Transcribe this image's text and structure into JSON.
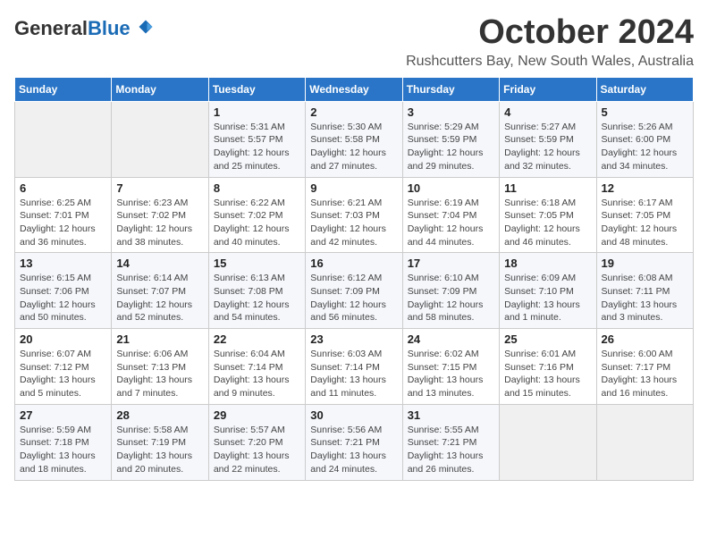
{
  "header": {
    "logo_general": "General",
    "logo_blue": "Blue",
    "month_title": "October 2024",
    "location": "Rushcutters Bay, New South Wales, Australia"
  },
  "days_of_week": [
    "Sunday",
    "Monday",
    "Tuesday",
    "Wednesday",
    "Thursday",
    "Friday",
    "Saturday"
  ],
  "weeks": [
    [
      {
        "day": "",
        "info": ""
      },
      {
        "day": "",
        "info": ""
      },
      {
        "day": "1",
        "info": "Sunrise: 5:31 AM\nSunset: 5:57 PM\nDaylight: 12 hours\nand 25 minutes."
      },
      {
        "day": "2",
        "info": "Sunrise: 5:30 AM\nSunset: 5:58 PM\nDaylight: 12 hours\nand 27 minutes."
      },
      {
        "day": "3",
        "info": "Sunrise: 5:29 AM\nSunset: 5:59 PM\nDaylight: 12 hours\nand 29 minutes."
      },
      {
        "day": "4",
        "info": "Sunrise: 5:27 AM\nSunset: 5:59 PM\nDaylight: 12 hours\nand 32 minutes."
      },
      {
        "day": "5",
        "info": "Sunrise: 5:26 AM\nSunset: 6:00 PM\nDaylight: 12 hours\nand 34 minutes."
      }
    ],
    [
      {
        "day": "6",
        "info": "Sunrise: 6:25 AM\nSunset: 7:01 PM\nDaylight: 12 hours\nand 36 minutes."
      },
      {
        "day": "7",
        "info": "Sunrise: 6:23 AM\nSunset: 7:02 PM\nDaylight: 12 hours\nand 38 minutes."
      },
      {
        "day": "8",
        "info": "Sunrise: 6:22 AM\nSunset: 7:02 PM\nDaylight: 12 hours\nand 40 minutes."
      },
      {
        "day": "9",
        "info": "Sunrise: 6:21 AM\nSunset: 7:03 PM\nDaylight: 12 hours\nand 42 minutes."
      },
      {
        "day": "10",
        "info": "Sunrise: 6:19 AM\nSunset: 7:04 PM\nDaylight: 12 hours\nand 44 minutes."
      },
      {
        "day": "11",
        "info": "Sunrise: 6:18 AM\nSunset: 7:05 PM\nDaylight: 12 hours\nand 46 minutes."
      },
      {
        "day": "12",
        "info": "Sunrise: 6:17 AM\nSunset: 7:05 PM\nDaylight: 12 hours\nand 48 minutes."
      }
    ],
    [
      {
        "day": "13",
        "info": "Sunrise: 6:15 AM\nSunset: 7:06 PM\nDaylight: 12 hours\nand 50 minutes."
      },
      {
        "day": "14",
        "info": "Sunrise: 6:14 AM\nSunset: 7:07 PM\nDaylight: 12 hours\nand 52 minutes."
      },
      {
        "day": "15",
        "info": "Sunrise: 6:13 AM\nSunset: 7:08 PM\nDaylight: 12 hours\nand 54 minutes."
      },
      {
        "day": "16",
        "info": "Sunrise: 6:12 AM\nSunset: 7:09 PM\nDaylight: 12 hours\nand 56 minutes."
      },
      {
        "day": "17",
        "info": "Sunrise: 6:10 AM\nSunset: 7:09 PM\nDaylight: 12 hours\nand 58 minutes."
      },
      {
        "day": "18",
        "info": "Sunrise: 6:09 AM\nSunset: 7:10 PM\nDaylight: 13 hours\nand 1 minute."
      },
      {
        "day": "19",
        "info": "Sunrise: 6:08 AM\nSunset: 7:11 PM\nDaylight: 13 hours\nand 3 minutes."
      }
    ],
    [
      {
        "day": "20",
        "info": "Sunrise: 6:07 AM\nSunset: 7:12 PM\nDaylight: 13 hours\nand 5 minutes."
      },
      {
        "day": "21",
        "info": "Sunrise: 6:06 AM\nSunset: 7:13 PM\nDaylight: 13 hours\nand 7 minutes."
      },
      {
        "day": "22",
        "info": "Sunrise: 6:04 AM\nSunset: 7:14 PM\nDaylight: 13 hours\nand 9 minutes."
      },
      {
        "day": "23",
        "info": "Sunrise: 6:03 AM\nSunset: 7:14 PM\nDaylight: 13 hours\nand 11 minutes."
      },
      {
        "day": "24",
        "info": "Sunrise: 6:02 AM\nSunset: 7:15 PM\nDaylight: 13 hours\nand 13 minutes."
      },
      {
        "day": "25",
        "info": "Sunrise: 6:01 AM\nSunset: 7:16 PM\nDaylight: 13 hours\nand 15 minutes."
      },
      {
        "day": "26",
        "info": "Sunrise: 6:00 AM\nSunset: 7:17 PM\nDaylight: 13 hours\nand 16 minutes."
      }
    ],
    [
      {
        "day": "27",
        "info": "Sunrise: 5:59 AM\nSunset: 7:18 PM\nDaylight: 13 hours\nand 18 minutes."
      },
      {
        "day": "28",
        "info": "Sunrise: 5:58 AM\nSunset: 7:19 PM\nDaylight: 13 hours\nand 20 minutes."
      },
      {
        "day": "29",
        "info": "Sunrise: 5:57 AM\nSunset: 7:20 PM\nDaylight: 13 hours\nand 22 minutes."
      },
      {
        "day": "30",
        "info": "Sunrise: 5:56 AM\nSunset: 7:21 PM\nDaylight: 13 hours\nand 24 minutes."
      },
      {
        "day": "31",
        "info": "Sunrise: 5:55 AM\nSunset: 7:21 PM\nDaylight: 13 hours\nand 26 minutes."
      },
      {
        "day": "",
        "info": ""
      },
      {
        "day": "",
        "info": ""
      }
    ]
  ]
}
